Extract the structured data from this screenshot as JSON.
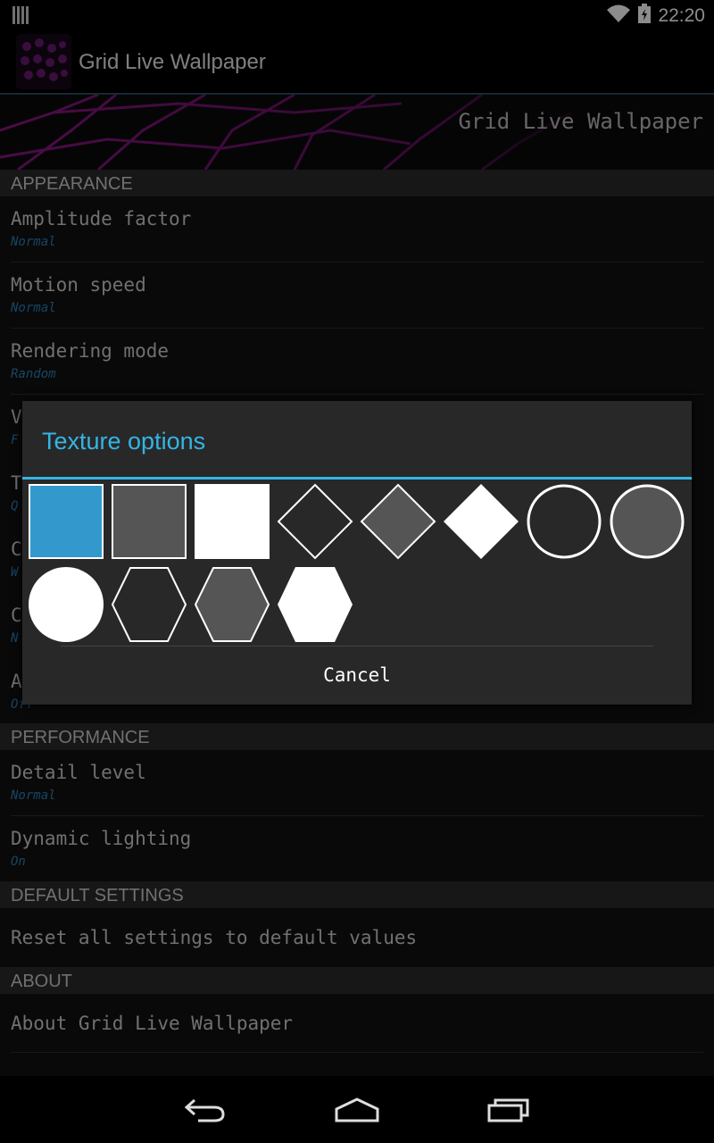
{
  "status_bar": {
    "time": "22:20"
  },
  "app": {
    "title": "Grid Live Wallpaper",
    "banner_title": "Grid Live Wallpaper"
  },
  "sections": {
    "appearance": "APPEARANCE",
    "performance": "PERFORMANCE",
    "default_settings": "DEFAULT SETTINGS",
    "about": "ABOUT"
  },
  "prefs": {
    "amplitude": {
      "title": "Amplitude factor",
      "summary": "Normal"
    },
    "motion": {
      "title": "Motion speed",
      "summary": "Normal"
    },
    "rendering": {
      "title": "Rendering mode",
      "summary": "Random"
    },
    "hidden_v": {
      "title": "V",
      "summary": "F"
    },
    "hidden_t": {
      "title": "T",
      "summary": "Q"
    },
    "hidden_c1": {
      "title": "C",
      "summary": "W"
    },
    "hidden_c2": {
      "title": "C",
      "summary": "N"
    },
    "hidden_a": {
      "title": "A",
      "summary": "Off"
    },
    "detail": {
      "title": "Detail level",
      "summary": "Normal"
    },
    "lighting": {
      "title": "Dynamic lighting",
      "summary": "On"
    },
    "reset": {
      "title": "Reset all settings to default values"
    },
    "about": {
      "title": "About Grid Live Wallpaper"
    }
  },
  "dialog": {
    "title": "Texture options",
    "cancel_label": "Cancel",
    "selected_index": 0,
    "textures": [
      "square-filled-blue",
      "square-gray",
      "square-white",
      "diamond-outline",
      "diamond-gray",
      "diamond-white",
      "circle-outline",
      "circle-gray",
      "circle-white",
      "hexagon-outline",
      "hexagon-gray",
      "hexagon-white"
    ]
  },
  "colors": {
    "accent": "#33b5e5",
    "summary": "#2a7fb8"
  }
}
